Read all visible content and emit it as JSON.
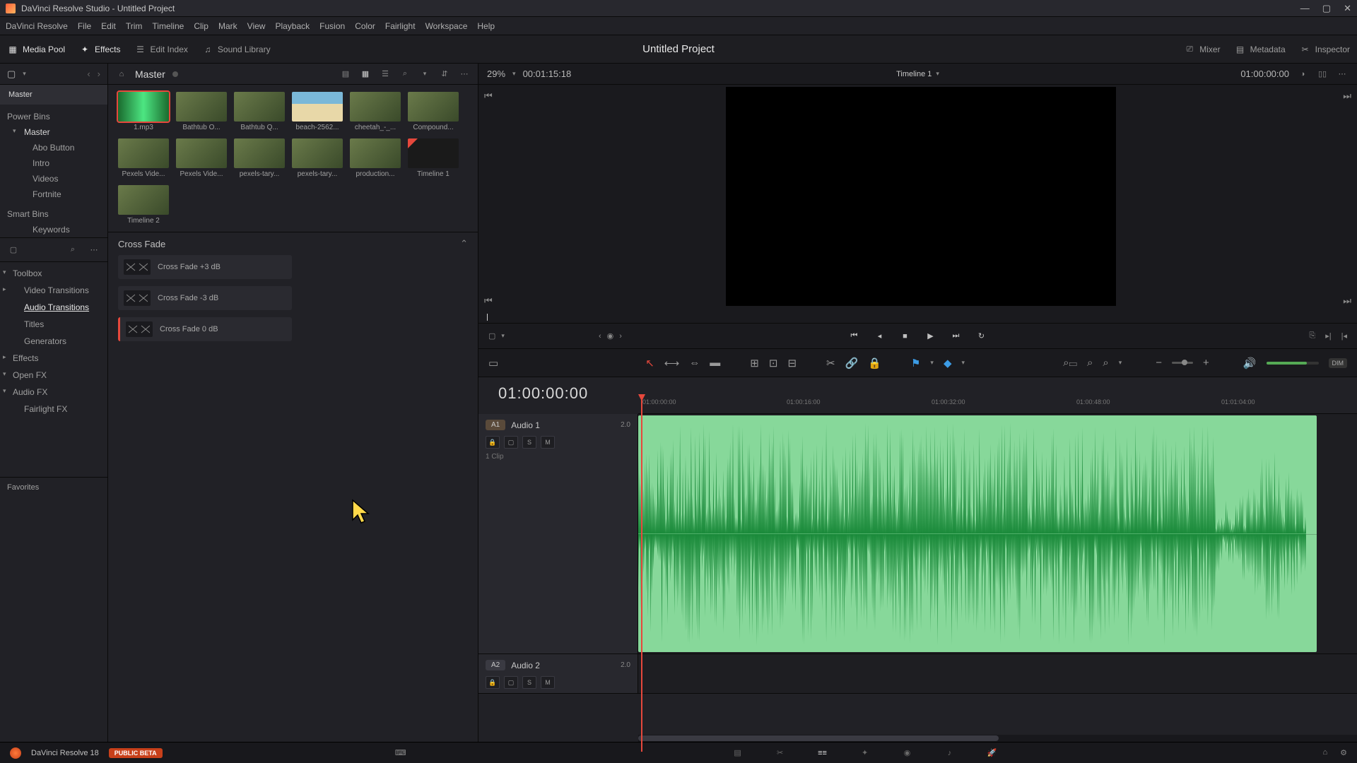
{
  "window_title": "DaVinci Resolve Studio - Untitled Project",
  "menubar": [
    "DaVinci Resolve",
    "File",
    "Edit",
    "Trim",
    "Timeline",
    "Clip",
    "Mark",
    "View",
    "Playback",
    "Fusion",
    "Color",
    "Fairlight",
    "Workspace",
    "Help"
  ],
  "toolbar": {
    "media_pool": "Media Pool",
    "effects": "Effects",
    "edit_index": "Edit Index",
    "sound_library": "Sound Library",
    "mixer": "Mixer",
    "metadata": "Metadata",
    "inspector": "Inspector"
  },
  "project_title": "Untitled Project",
  "bins": {
    "master": "Master",
    "power_bins": "Power Bins",
    "power_items": [
      "Master",
      "Abo Button",
      "Intro",
      "Videos",
      "Fortnite"
    ],
    "smart_bins": "Smart Bins",
    "smart_items": [
      "Keywords"
    ]
  },
  "media": {
    "breadcrumb": "Master",
    "zoom": "29%",
    "src_tc": "00:01:15:18",
    "clips": [
      {
        "label": "1.mp3",
        "kind": "audio",
        "sel": true
      },
      {
        "label": "Bathtub O...",
        "kind": "video"
      },
      {
        "label": "Bathtub Q...",
        "kind": "video"
      },
      {
        "label": "beach-2562...",
        "kind": "beach"
      },
      {
        "label": "cheetah_-_...",
        "kind": "video"
      },
      {
        "label": "Compound...",
        "kind": "video"
      },
      {
        "label": "Pexels Vide...",
        "kind": "video"
      },
      {
        "label": "Pexels Vide...",
        "kind": "video"
      },
      {
        "label": "pexels-tary...",
        "kind": "video"
      },
      {
        "label": "pexels-tary...",
        "kind": "video"
      },
      {
        "label": "production...",
        "kind": "video"
      },
      {
        "label": "Timeline 1",
        "kind": "timeline"
      },
      {
        "label": "Timeline 2",
        "kind": "video"
      }
    ]
  },
  "effects_tree": {
    "toolbox": "Toolbox",
    "video_transitions": "Video Transitions",
    "audio_transitions": "Audio Transitions",
    "titles": "Titles",
    "generators": "Generators",
    "effects": "Effects",
    "open_fx": "Open FX",
    "audio_fx": "Audio FX",
    "fairlight_fx": "Fairlight FX",
    "favorites": "Favorites"
  },
  "effects_list": {
    "category": "Cross Fade",
    "items": [
      "Cross Fade +3 dB",
      "Cross Fade -3 dB",
      "Cross Fade 0 dB"
    ]
  },
  "viewer": {
    "timeline_name": "Timeline 1",
    "rec_tc": "01:00:00:00"
  },
  "timeline": {
    "tc": "01:00:00:00",
    "ruler": [
      "01:00:00:00",
      "01:00:16:00",
      "01:00:32:00",
      "01:00:48:00",
      "01:01:04:00"
    ],
    "tracks": [
      {
        "tag": "A1",
        "name": "Audio 1",
        "ch": "2.0",
        "clips_text": "1 Clip"
      },
      {
        "tag": "A2",
        "name": "Audio 2",
        "ch": "2.0"
      }
    ]
  },
  "footer": {
    "app": "DaVinci Resolve 18",
    "badge": "PUBLIC BETA"
  }
}
